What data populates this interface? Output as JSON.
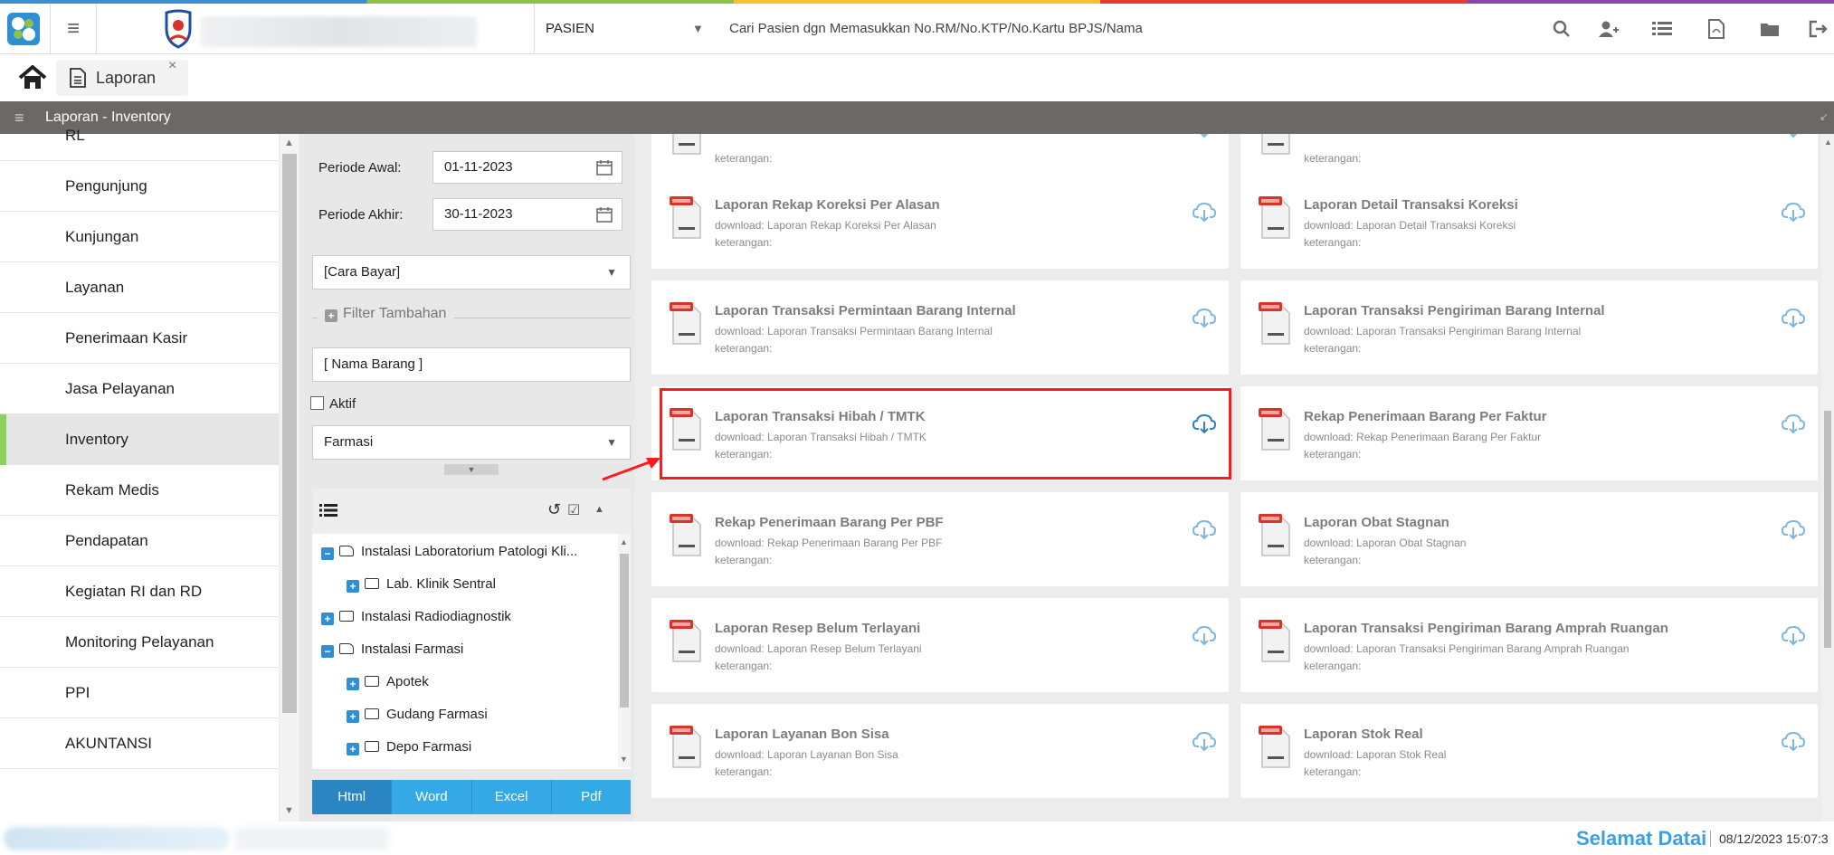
{
  "topbar": {
    "module": "PASIEN",
    "search_placeholder": "Cari Pasien dgn Memasukkan No.RM/No.KTP/No.Kartu BPJS/Nama"
  },
  "tabs": [
    {
      "label": "Laporan"
    }
  ],
  "header": {
    "title": "Laporan - Inventory"
  },
  "sidebar": {
    "items": [
      {
        "label": "RL"
      },
      {
        "label": "Pengunjung"
      },
      {
        "label": "Kunjungan"
      },
      {
        "label": "Layanan"
      },
      {
        "label": "Penerimaan Kasir"
      },
      {
        "label": "Jasa Pelayanan"
      },
      {
        "label": "Inventory"
      },
      {
        "label": "Rekam Medis"
      },
      {
        "label": "Pendapatan"
      },
      {
        "label": "Kegiatan RI dan RD"
      },
      {
        "label": "Monitoring Pelayanan"
      },
      {
        "label": "PPI"
      },
      {
        "label": "AKUNTANSI"
      }
    ],
    "active": "Inventory"
  },
  "filter": {
    "periode_awal_label": "Periode Awal:",
    "periode_awal_value": "01-11-2023",
    "periode_akhir_label": "Periode Akhir:",
    "periode_akhir_value": "30-11-2023",
    "cara_bayar": "[Cara Bayar]",
    "filter_tambahan": "Filter Tambahan",
    "nama_barang": "[ Nama Barang ]",
    "aktif_label": "Aktif",
    "unit_select": "Farmasi"
  },
  "tree": {
    "nodes": [
      {
        "label": "Instalasi Laboratorium Patologi Kli..."
      },
      {
        "label": "Lab. Klinik Sentral"
      },
      {
        "label": "Instalasi Radiodiagnostik"
      },
      {
        "label": "Instalasi Farmasi"
      },
      {
        "label": "Apotek"
      },
      {
        "label": "Gudang Farmasi"
      },
      {
        "label": "Depo Farmasi"
      }
    ]
  },
  "export": {
    "html": "Html",
    "word": "Word",
    "excel": "Excel",
    "pdf": "Pdf"
  },
  "reports": [
    {
      "title": "",
      "download": "",
      "keterangan": "keterangan:"
    },
    {
      "title": "",
      "download": "",
      "keterangan": "keterangan:"
    },
    {
      "title": "Laporan Rekap Koreksi Per Alasan",
      "download": "download: Laporan Rekap Koreksi Per Alasan",
      "keterangan": "keterangan:"
    },
    {
      "title": "Laporan Detail Transaksi Koreksi",
      "download": "download: Laporan Detail Transaksi Koreksi",
      "keterangan": "keterangan:"
    },
    {
      "title": "Laporan Transaksi Permintaan Barang Internal",
      "download": "download: Laporan Transaksi Permintaan Barang Internal",
      "keterangan": "keterangan:"
    },
    {
      "title": "Laporan Transaksi Pengiriman Barang Internal",
      "download": "download: Laporan Transaksi Pengiriman Barang Internal",
      "keterangan": "keterangan:"
    },
    {
      "title": "Laporan Transaksi Hibah / TMTK",
      "download": "download: Laporan Transaksi Hibah / TMTK",
      "keterangan": "keterangan:"
    },
    {
      "title": "Rekap Penerimaan Barang Per Faktur",
      "download": "download: Rekap Penerimaan Barang Per Faktur",
      "keterangan": "keterangan:"
    },
    {
      "title": "Rekap Penerimaan Barang Per PBF",
      "download": "download: Rekap Penerimaan Barang Per PBF",
      "keterangan": "keterangan:"
    },
    {
      "title": "Laporan Obat Stagnan",
      "download": "download: Laporan Obat Stagnan",
      "keterangan": "keterangan:"
    },
    {
      "title": "Laporan Resep Belum Terlayani",
      "download": "download: Laporan Resep Belum Terlayani",
      "keterangan": "keterangan:"
    },
    {
      "title": "Laporan Transaksi Pengiriman Barang Amprah Ruangan",
      "download": "download: Laporan Transaksi Pengiriman Barang Amprah Ruangan",
      "keterangan": "keterangan:"
    },
    {
      "title": "Laporan Layanan Bon Sisa",
      "download": "download: Laporan Layanan Bon Sisa",
      "keterangan": "keterangan:"
    },
    {
      "title": "Laporan Stok Real",
      "download": "download: Laporan Stok Real",
      "keterangan": "keterangan:"
    }
  ],
  "highlighted_report": "Laporan Transaksi Hibah / TMTK",
  "footer": {
    "welcome": "Selamat Datai",
    "datetime": "08/12/2023 15:07:3"
  },
  "colors": {
    "accent": "#3aa0e6",
    "header_bg": "#6c6866",
    "active_indicator": "#8ed15a",
    "highlight": "#ff1a1a",
    "export_btn": "#35a9e6"
  }
}
